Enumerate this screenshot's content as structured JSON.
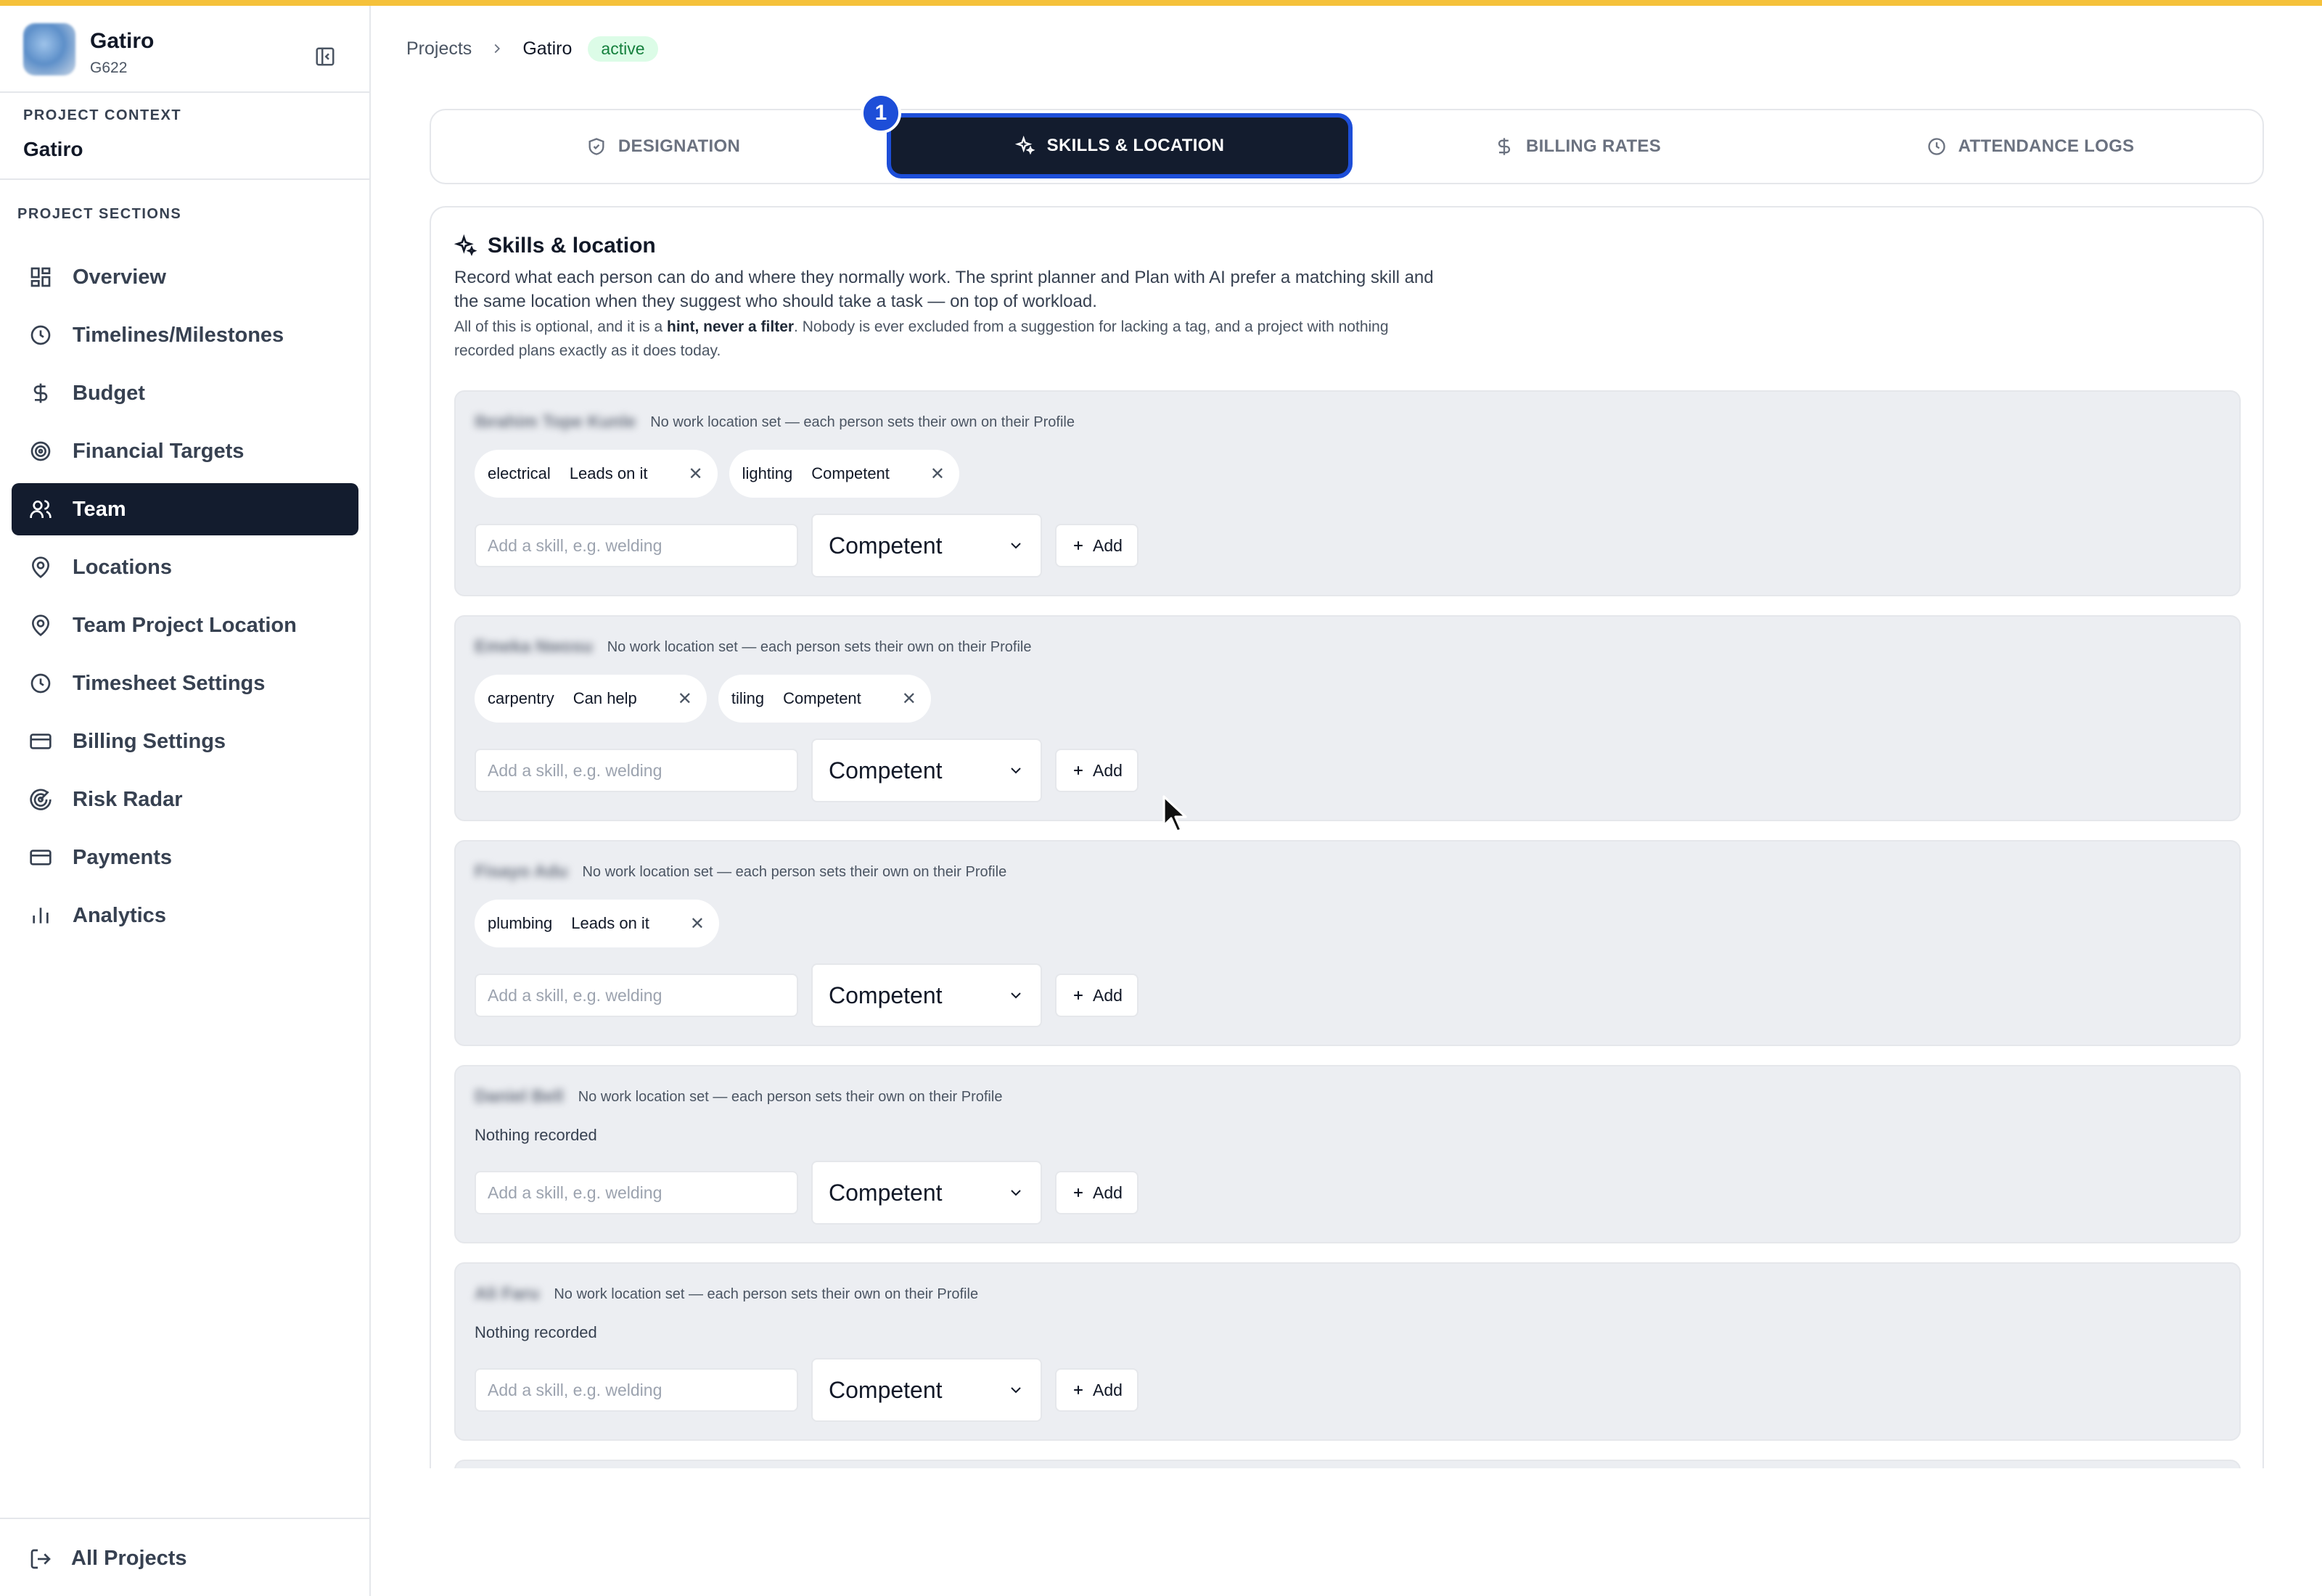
{
  "colors": {
    "accent_bar": "#f5c13a",
    "nav_active_bg": "#131c2e",
    "tab_focus_ring": "#1d4ed8",
    "badge_bg": "#dcfce7",
    "badge_text": "#15803d",
    "card_bg": "#eceef2"
  },
  "brand": {
    "name": "Gatiro",
    "code": "G622",
    "logo": "project-logo-image"
  },
  "context": {
    "label": "PROJECT CONTEXT",
    "value": "Gatiro"
  },
  "sections_label": "PROJECT SECTIONS",
  "nav": [
    {
      "label": "Overview",
      "icon": "grid-icon"
    },
    {
      "label": "Timelines/Milestones",
      "icon": "clock-icon"
    },
    {
      "label": "Budget",
      "icon": "dollar-icon"
    },
    {
      "label": "Financial Targets",
      "icon": "target-icon"
    },
    {
      "label": "Team",
      "icon": "users-icon",
      "active": true
    },
    {
      "label": "Locations",
      "icon": "map-pin-icon"
    },
    {
      "label": "Team Project Location",
      "icon": "map-pin-icon"
    },
    {
      "label": "Timesheet Settings",
      "icon": "clock-icon"
    },
    {
      "label": "Billing Settings",
      "icon": "credit-card-icon"
    },
    {
      "label": "Risk Radar",
      "icon": "radar-icon"
    },
    {
      "label": "Payments",
      "icon": "credit-card-icon"
    },
    {
      "label": "Analytics",
      "icon": "bar-chart-icon"
    }
  ],
  "footer": {
    "label": "All Projects",
    "icon": "log-out-icon"
  },
  "breadcrumb": {
    "root": "Projects",
    "current": "Gatiro",
    "status": "active"
  },
  "tabs": [
    {
      "label": "DESIGNATION",
      "icon": "shield-check-icon"
    },
    {
      "label": "SKILLS & LOCATION",
      "icon": "sparkles-icon",
      "active": true
    },
    {
      "label": "BILLING RATES",
      "icon": "dollar-icon"
    },
    {
      "label": "ATTENDANCE LOGS",
      "icon": "clock-icon"
    }
  ],
  "step_badge": "1",
  "panel": {
    "title": "Skills & location",
    "description": "Record what each person can do and where they normally work. The sprint planner and Plan with AI prefer a matching skill and the same location when they suggest who should take a task — on top of workload.",
    "note_prefix": "All of this is optional, and it is a ",
    "note_bold": "hint, never a filter",
    "note_suffix": ". Nobody is ever excluded from a suggestion for lacking a tag, and a project with nothing recorded plans exactly as it does today."
  },
  "form": {
    "placeholder": "Add a skill, e.g. welding",
    "level": "Competent",
    "add_label": "Add"
  },
  "people": [
    {
      "name": "Ibrahim Tope Kunle",
      "location_note": "No work location set — each person sets their own on their Profile",
      "skills": [
        {
          "skill": "electrical",
          "level": "Leads on it"
        },
        {
          "skill": "lighting",
          "level": "Competent"
        }
      ]
    },
    {
      "name": "Emeka Nwosu",
      "location_note": "No work location set — each person sets their own on their Profile",
      "skills": [
        {
          "skill": "carpentry",
          "level": "Can help"
        },
        {
          "skill": "tiling",
          "level": "Competent"
        }
      ]
    },
    {
      "name": "Fisayo Adu",
      "location_note": "No work location set — each person sets their own on their Profile",
      "skills": [
        {
          "skill": "plumbing",
          "level": "Leads on it"
        }
      ]
    },
    {
      "name": "Daniel Bell",
      "location_note": "No work location set — each person sets their own on their Profile",
      "skills": [],
      "empty_text": "Nothing recorded"
    },
    {
      "name": "Ali Faru",
      "location_note": "No work location set — each person sets their own on their Profile",
      "skills": [],
      "empty_text": "Nothing recorded"
    }
  ]
}
